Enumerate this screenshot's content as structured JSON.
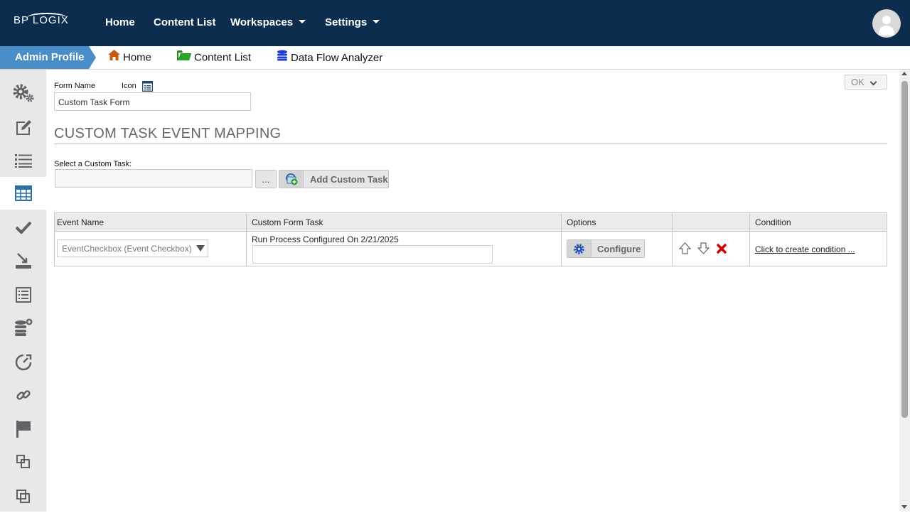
{
  "header": {
    "logo_text": "BP LOGIX",
    "nav": [
      {
        "label": "Home"
      },
      {
        "label": "Content List"
      },
      {
        "label": "Workspaces"
      },
      {
        "label": "Settings"
      }
    ]
  },
  "breadcrumb": {
    "profile": "Admin Profile",
    "items": [
      {
        "label": "Home",
        "icon": "home-icon"
      },
      {
        "label": "Content List",
        "icon": "folder-icon"
      },
      {
        "label": "Data Flow Analyzer",
        "icon": "database-icon"
      }
    ]
  },
  "sidebar": {
    "items": [
      "gears-icon",
      "edit-icon",
      "list-icon",
      "table-icon",
      "checkmark-icon",
      "import-icon",
      "document-list-icon",
      "database-add-icon",
      "dashboard-icon",
      "link-icon",
      "flag-icon",
      "copy-icon",
      "duplicate-icon"
    ],
    "active_index": 3
  },
  "form": {
    "form_name_label": "Form Name",
    "icon_label": "Icon",
    "form_name_value": "Custom Task Form",
    "ok_label": "OK"
  },
  "section": {
    "title": "CUSTOM TASK EVENT MAPPING",
    "select_label": "Select a Custom Task:",
    "select_value": "",
    "browse_label": "...",
    "add_label": "Add Custom Task"
  },
  "table": {
    "headers": [
      "Event Name",
      "Custom Form Task",
      "Options",
      "",
      "Condition"
    ],
    "rows": [
      {
        "event": "EventCheckbox (Event Checkbox)",
        "task_text": "Run Process Configured On 2/21/2025",
        "task_input": "",
        "configure_label": "Configure",
        "condition_link": "Click to create condition ..."
      }
    ]
  },
  "colors": {
    "header_bg": "#0c2d4e",
    "profile_bg": "#4a8ec9",
    "sidebar_bg": "#e8e8e8",
    "icon_gray": "#5f6368",
    "delete_red": "#d00000"
  }
}
